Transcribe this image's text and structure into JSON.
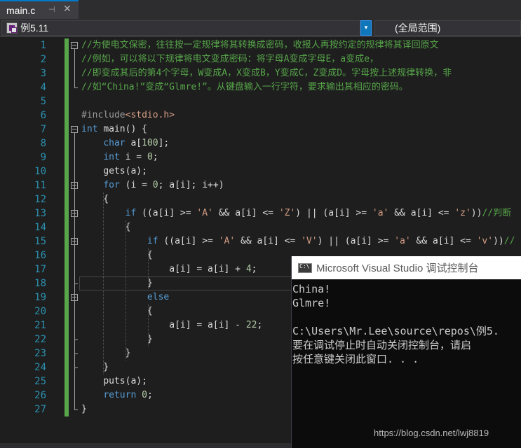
{
  "tab": {
    "title": "main.c",
    "pin": "⊣",
    "close": "✕"
  },
  "navbar": {
    "project": "例5.11",
    "dropdown_arrow": "▾",
    "scope": "(全局范围)"
  },
  "editor": {
    "line_numbers": [
      "1",
      "2",
      "3",
      "4",
      "5",
      "6",
      "7",
      "8",
      "9",
      "10",
      "11",
      "12",
      "13",
      "14",
      "15",
      "16",
      "17",
      "18",
      "19",
      "20",
      "21",
      "22",
      "23",
      "24",
      "25",
      "26",
      "27"
    ],
    "lines": [
      "//为使电文保密，往往按一定规律将其转换成密码，收报人再按约定的规律将其译回原文",
      "//例如，可以将以下规律将电文变成密码：将字母A变成字母E，a变成e，",
      "//即变成其后的第4个字母，W变成A，X变成B，Y变成C，Z变成D。字母按上述规律转换，非",
      "//如“China!”变成“Glmre!”。从键盘输入一行字符，要求输出其相应的密码。",
      "",
      "#include<stdio.h>",
      "int main() {",
      "    char a[100];",
      "    int i = 0;",
      "    gets(a);",
      "    for (i = 0; a[i]; i++)",
      "    {",
      "        if ((a[i] >= 'A' && a[i] <= 'Z') || (a[i] >= 'a' && a[i] <= 'z'))//判断",
      "        {",
      "            if ((a[i] >= 'A' && a[i] <= 'V') || (a[i] >= 'a' && a[i] <= 'v'))//",
      "            {",
      "                a[i] = a[i] + 4;",
      "            }",
      "            else",
      "            {",
      "                a[i] = a[i] - 22;",
      "            }",
      "        }",
      "    }",
      "    puts(a);",
      "    return 0;",
      "}"
    ]
  },
  "console": {
    "title": "Microsoft Visual Studio 调试控制台",
    "lines": [
      "China!",
      "Glmre!",
      "",
      "C:\\Users\\Mr.Lee\\source\\repos\\例5.",
      "要在调试停止时自动关闭控制台，请启",
      "按任意键关闭此窗口. . ."
    ],
    "watermark": "https://blog.csdn.net/lwj8819"
  },
  "colors": {
    "comment": "#57a64a",
    "keyword": "#569cd6",
    "preprocessor": "#9b9b9b",
    "string": "#d69d85",
    "number": "#b5cea8",
    "line_number": "#2b91af",
    "accent": "#007acc"
  },
  "icons": {
    "tab_pin": "pin-icon",
    "tab_close": "close-icon",
    "project": "project-icon",
    "console": "console-app-icon"
  }
}
